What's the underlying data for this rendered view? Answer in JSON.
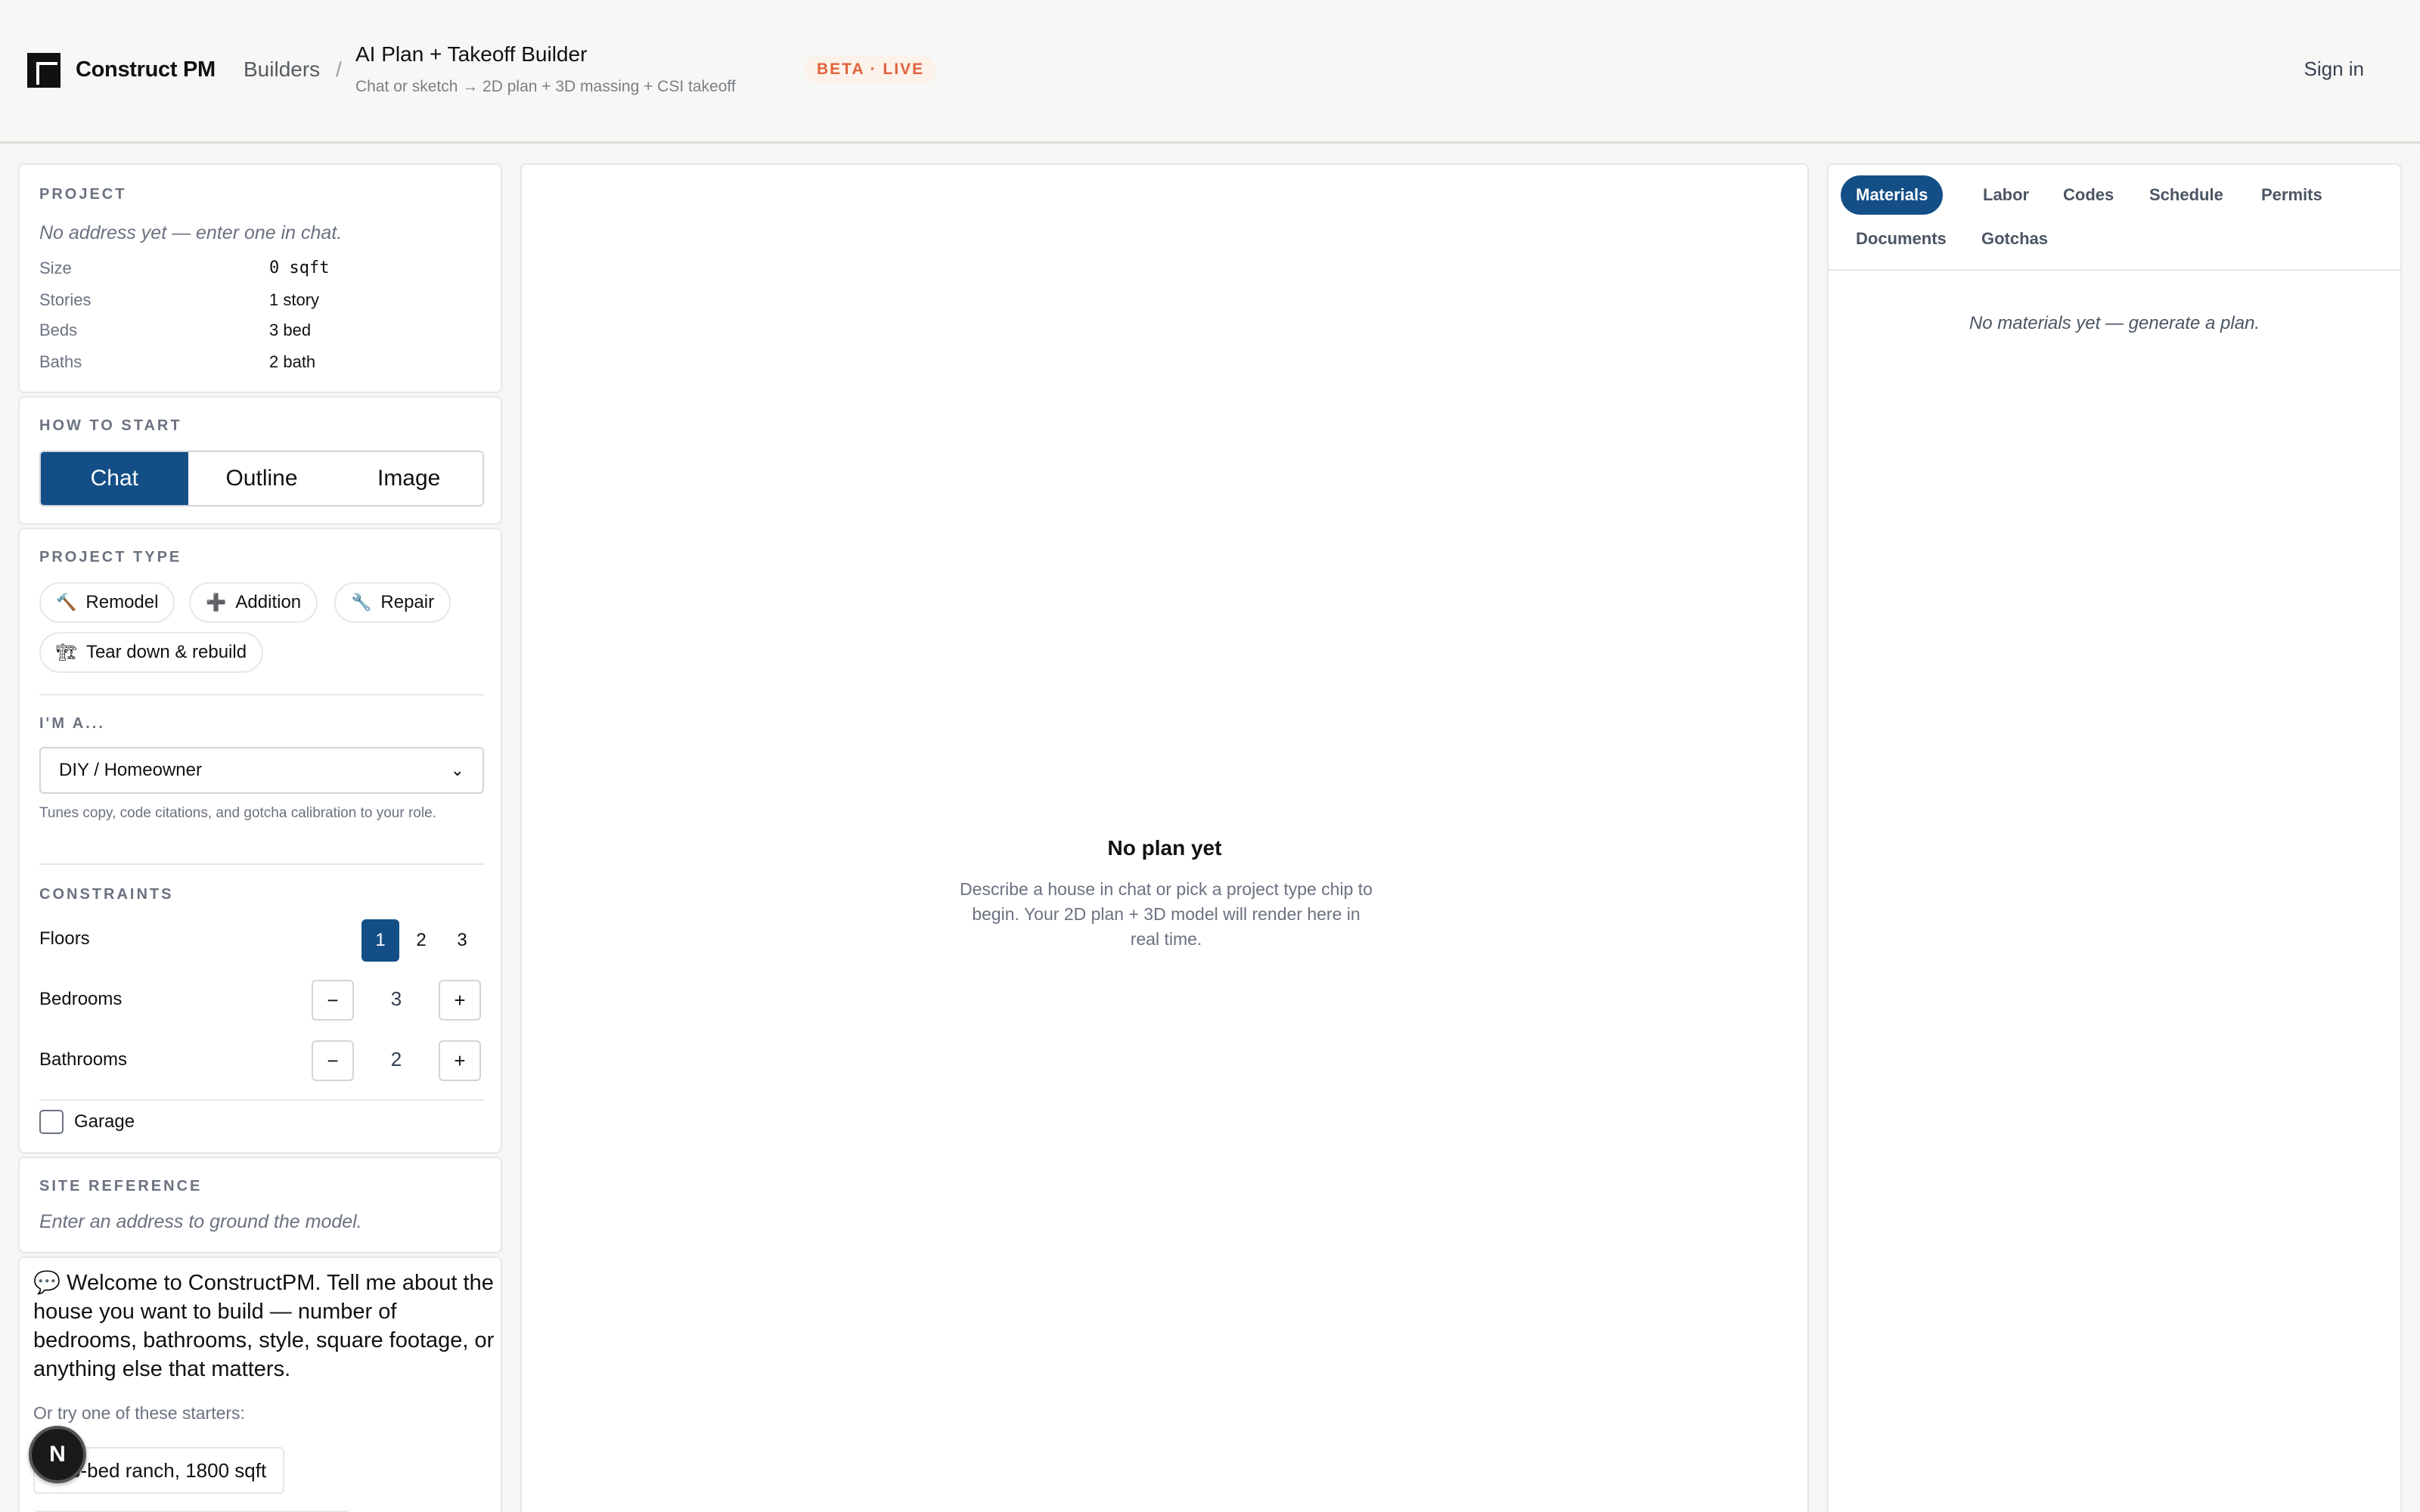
{
  "header": {
    "brand": "Construct PM",
    "breadcrumb_builders": "Builders",
    "breadcrumb_sep": "/",
    "title": "AI Plan + Takeoff Builder",
    "subtitle": "Chat or sketch → 2D plan + 3D massing + CSI takeoff",
    "badge": "BETA · LIVE",
    "sign_in": "Sign in"
  },
  "project": {
    "label": "PROJECT",
    "address_hint": "No address yet — enter one in chat.",
    "rows": [
      {
        "key": "Size",
        "value": "0 sqft"
      },
      {
        "key": "Stories",
        "value": "1 story"
      },
      {
        "key": "Beds",
        "value": "3 bed"
      },
      {
        "key": "Baths",
        "value": "2 bath"
      }
    ]
  },
  "how_to_start": {
    "label": "HOW TO START",
    "options": [
      "Chat",
      "Outline",
      "Image"
    ],
    "selected": "Chat"
  },
  "project_type": {
    "label": "PROJECT TYPE",
    "chips": [
      {
        "icon": "🔨",
        "label": "Remodel"
      },
      {
        "icon": "➕",
        "label": "Addition"
      },
      {
        "icon": "🔧",
        "label": "Repair"
      },
      {
        "icon": "🏗",
        "label": "Tear down & rebuild"
      }
    ]
  },
  "role": {
    "label": "I'M A...",
    "selected": "DIY / Homeowner",
    "help": "Tunes copy, code citations, and gotcha calibration to your role."
  },
  "constraints": {
    "label": "CONSTRAINTS",
    "floors_label": "Floors",
    "floors_options": [
      "1",
      "2",
      "3"
    ],
    "floors_selected": "1",
    "bedrooms_label": "Bedrooms",
    "bedrooms": "3",
    "bathrooms_label": "Bathrooms",
    "bathrooms": "2",
    "minus": "−",
    "plus": "+",
    "garage_label": "Garage",
    "garage_checked": false
  },
  "site_reference": {
    "label": "SITE REFERENCE",
    "hint": "Enter an address to ground the model."
  },
  "chat": {
    "welcome": "💬 Welcome to ConstructPM. Tell me about the house you want to build — number of bedrooms, bathrooms, style, square footage, or anything else that matters.",
    "starters_label": "Or try one of these starters:",
    "starters": [
      "3-bed ranch, 1800 sqft"
    ],
    "n_badge": "N"
  },
  "canvas": {
    "empty_title": "No plan yet",
    "empty_desc": "Describe a house in chat or pick a project type chip to begin. Your 2D plan + 3D model will render here in real time."
  },
  "right_panel": {
    "tabs": [
      "Materials",
      "Labor",
      "Codes",
      "Schedule",
      "Permits",
      "Documents",
      "Gotchas"
    ],
    "active_tab": "Materials",
    "empty": "No materials yet — generate a plan."
  },
  "colors": {
    "accent": "#134f86",
    "badge_text": "#e2623b",
    "badge_bg": "#fdf2ea"
  }
}
